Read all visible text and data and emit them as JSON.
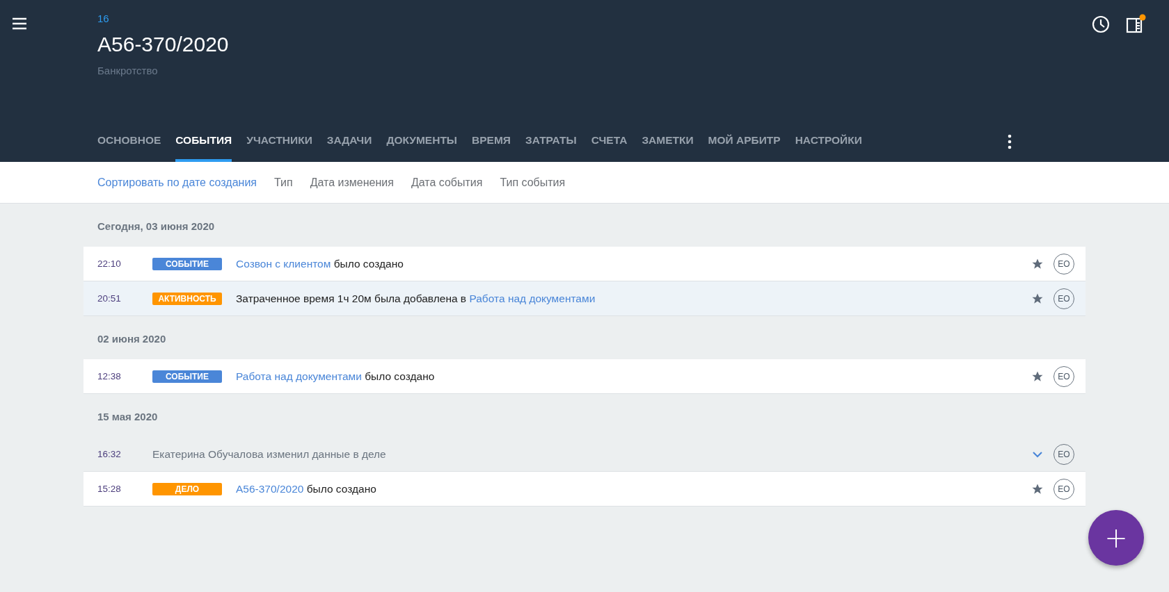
{
  "header": {
    "number": "16",
    "title": "А56-370/2020",
    "subtitle": "Банкротство",
    "notification": true
  },
  "tabs": [
    {
      "label": "ОСНОВНОЕ",
      "selected": false
    },
    {
      "label": "СОБЫТИЯ",
      "selected": true
    },
    {
      "label": "УЧАСТНИКИ",
      "selected": false
    },
    {
      "label": "ЗАДАЧИ",
      "selected": false
    },
    {
      "label": "ДОКУМЕНТЫ",
      "selected": false
    },
    {
      "label": "ВРЕМЯ",
      "selected": false
    },
    {
      "label": "ЗАТРАТЫ",
      "selected": false
    },
    {
      "label": "СЧЕТА",
      "selected": false
    },
    {
      "label": "ЗАМЕТКИ",
      "selected": false
    },
    {
      "label": "МОЙ АРБИТР",
      "selected": false
    },
    {
      "label": "НАСТРОЙКИ",
      "selected": false
    }
  ],
  "sort_options": [
    {
      "label": "Сортировать по дате создания",
      "selected": true
    },
    {
      "label": "Тип",
      "selected": false
    },
    {
      "label": "Дата изменения",
      "selected": false
    },
    {
      "label": "Дата события",
      "selected": false
    },
    {
      "label": "Тип события",
      "selected": false
    }
  ],
  "groups": [
    {
      "date": "Сегодня, 03 июня 2020",
      "events": [
        {
          "kind": "badge",
          "time": "22:10",
          "badge": "СОБЫТИЕ",
          "color": "#4a86d8",
          "link": "Созвон с клиентом",
          "text": "было создано",
          "link_first": true,
          "highlighted": false,
          "avatar": "EO"
        },
        {
          "kind": "badge",
          "time": "20:51",
          "badge": "АКТИВНОСТЬ",
          "color": "#ff9500",
          "link": "Работа над документами",
          "text": "Затраченное время 1ч 20м была добавлена в",
          "link_first": false,
          "highlighted": true,
          "avatar": "EO"
        }
      ]
    },
    {
      "date": "02 июня 2020",
      "events": [
        {
          "kind": "badge",
          "time": "12:38",
          "badge": "СОБЫТИЕ",
          "color": "#4a86d8",
          "link": "Работа над документами",
          "text": "было создано",
          "link_first": true,
          "highlighted": false,
          "avatar": "EO"
        }
      ]
    },
    {
      "date": "15 мая 2020",
      "events": [
        {
          "kind": "change",
          "time": "16:32",
          "text": "Екатерина Обучалова изменил данные в деле",
          "avatar": "EO"
        },
        {
          "kind": "badge",
          "time": "15:28",
          "badge": "ДЕЛО",
          "color": "#ff9500",
          "link": "А56-370/2020",
          "text": "было создано",
          "link_first": true,
          "highlighted": false,
          "avatar": "EO"
        }
      ]
    }
  ],
  "fab": {
    "label": "+"
  }
}
